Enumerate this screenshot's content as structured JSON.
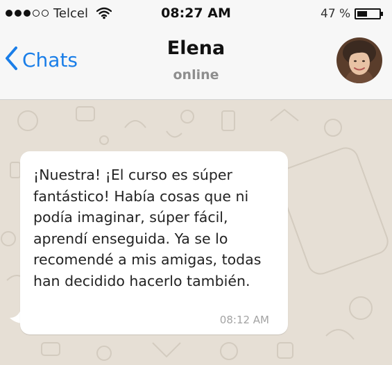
{
  "status_bar": {
    "signal_dots_filled": 3,
    "signal_dots_total": 5,
    "carrier": "Telcel",
    "wifi_icon": "wifi-icon",
    "time": "08:27 AM",
    "battery_percent_label": "47 %",
    "battery_level": 0.47
  },
  "nav": {
    "back_label": "Chats",
    "back_icon": "chevron-left-icon",
    "contact_name": "Elena",
    "contact_status": "online",
    "avatar_icon": "contact-avatar"
  },
  "messages": [
    {
      "direction": "incoming",
      "text": "¡Nuestra! ¡El curso es súper fantástico! Había cosas que ni podía imaginar, súper fácil, aprendí enseguida. Ya se lo recomendé a mis amigas, todas han decidido hacerlo también.",
      "time": "08:12 AM"
    }
  ],
  "colors": {
    "accent": "#1a7ee8",
    "chat_background": "#e6dfd5",
    "bubble": "#ffffff",
    "bar_background": "#f7f7f7"
  }
}
